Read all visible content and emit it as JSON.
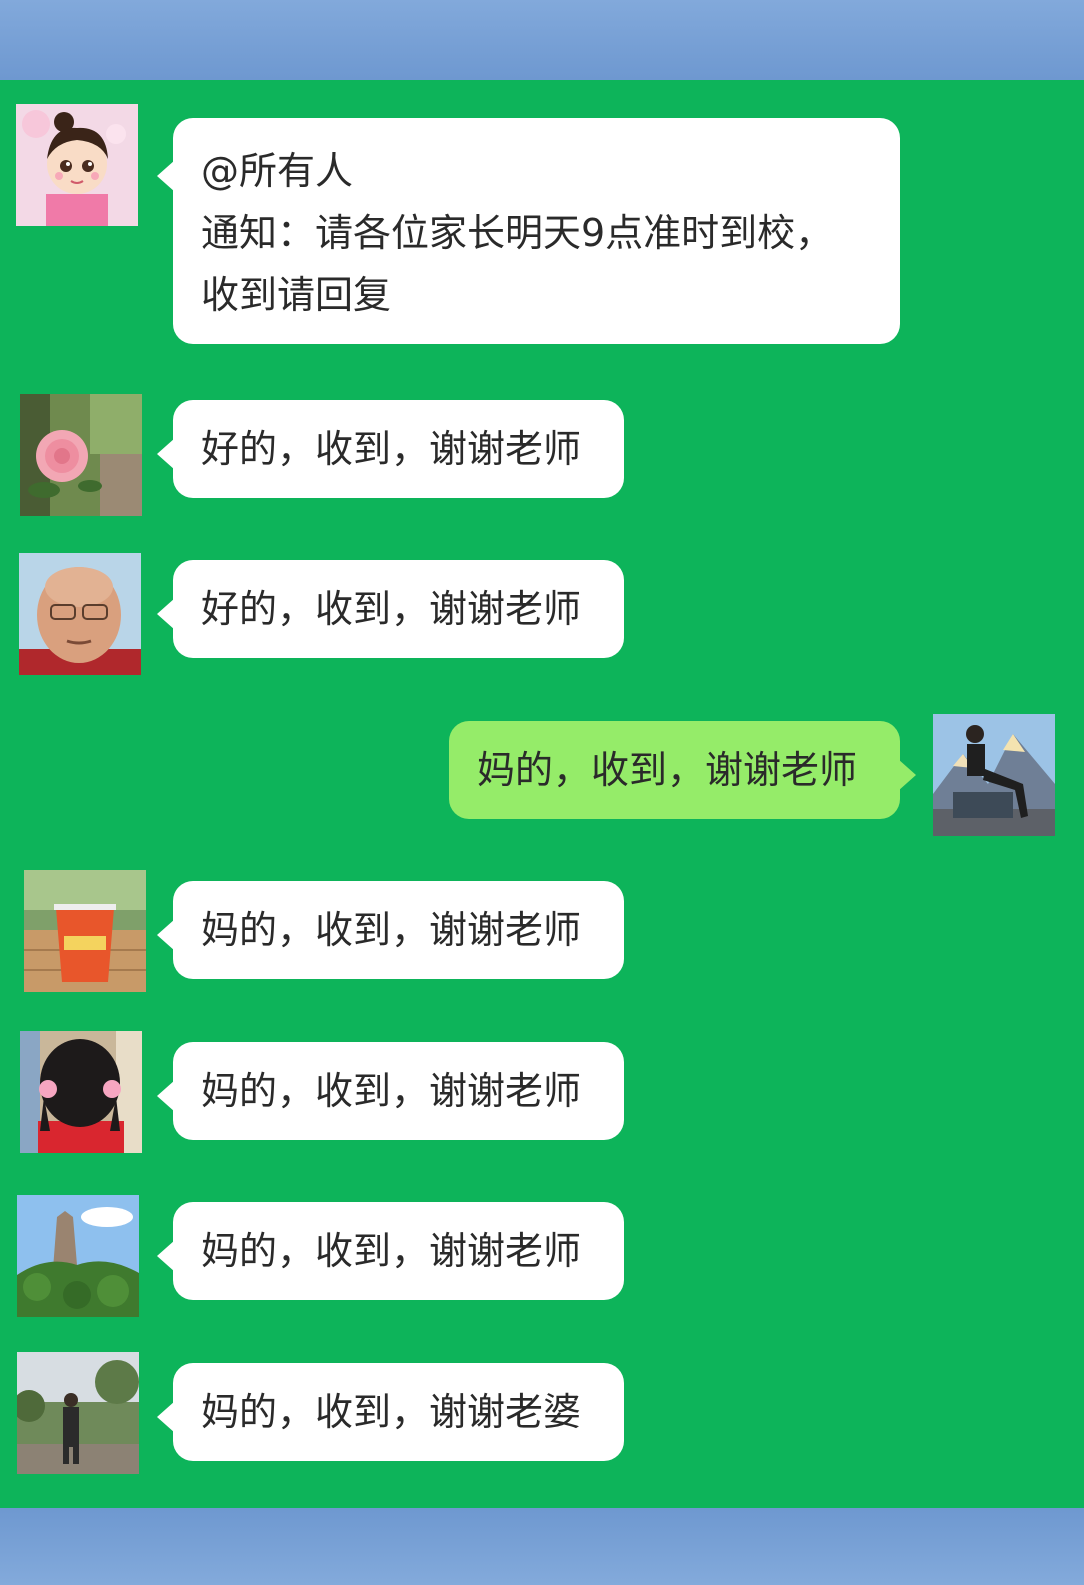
{
  "colors": {
    "chat_background": "#0db45a",
    "incoming_bubble": "#ffffff",
    "outgoing_bubble": "#95ec69",
    "frame_blue": "#6d97cf"
  },
  "messages": [
    {
      "sender_avatar": "cartoon-girl-avatar",
      "direction": "incoming",
      "lines": [
        "@所有人",
        "通知：请各位家长明天9点准时到校，",
        "收到请回复"
      ]
    },
    {
      "sender_avatar": "rose-avatar",
      "direction": "incoming",
      "text": "好的，收到，谢谢老师"
    },
    {
      "sender_avatar": "elderly-man-avatar",
      "direction": "incoming",
      "text": "好的，收到，谢谢老师"
    },
    {
      "sender_avatar": "mountain-man-avatar",
      "direction": "outgoing",
      "text": "妈的，收到，谢谢老师"
    },
    {
      "sender_avatar": "drink-cup-avatar",
      "direction": "incoming",
      "text": "妈的，收到，谢谢老师"
    },
    {
      "sender_avatar": "girl-back-avatar",
      "direction": "incoming",
      "text": "妈的，收到，谢谢老师"
    },
    {
      "sender_avatar": "rock-peak-avatar",
      "direction": "incoming",
      "text": "妈的，收到，谢谢老师"
    },
    {
      "sender_avatar": "garden-man-avatar",
      "direction": "incoming",
      "text": "妈的，收到，谢谢老婆"
    }
  ]
}
